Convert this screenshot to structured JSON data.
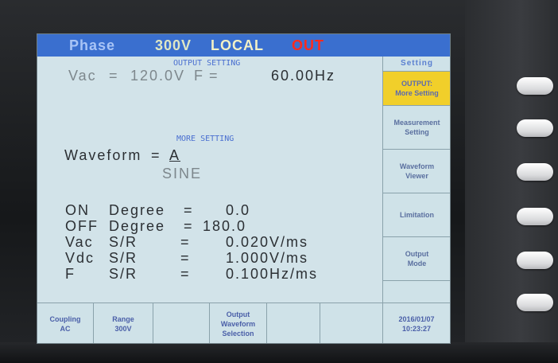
{
  "status": {
    "phase": "Phase",
    "voltage_range": "300V",
    "mode": "LOCAL",
    "output_state": "OUT"
  },
  "output_setting": {
    "title": "OUTPUT SETTING",
    "vac_label": "Vac",
    "eq1": "=",
    "vac_value": "120.0V",
    "f_label": "F",
    "eq2": "=",
    "f_value": "60.00Hz"
  },
  "more_setting": {
    "title": "MORE SETTING",
    "waveform_label": "Waveform",
    "eq": "=",
    "waveform_value": "A",
    "waveform_name": "SINE",
    "rows": [
      {
        "a": "ON",
        "b": "Degree",
        "eq": "=",
        "value": "0.0"
      },
      {
        "a": "OFF",
        "b": "Degree",
        "eq": "=",
        "value": "180.0"
      },
      {
        "a": "Vac",
        "b": "S/R",
        "eq": "=",
        "value": "0.020V/ms"
      },
      {
        "a": "Vdc",
        "b": "S/R",
        "eq": "=",
        "value": "1.000V/ms"
      },
      {
        "a": "F",
        "b": "S/R",
        "eq": "=",
        "value": "0.100Hz/ms"
      }
    ]
  },
  "side_menu": {
    "header": "Setting",
    "items": [
      {
        "line1": "OUTPUT:",
        "line2": "More Setting"
      },
      {
        "line1": "Measurement",
        "line2": "Setting"
      },
      {
        "line1": "Waveform",
        "line2": "Viewer"
      },
      {
        "line1": "Limitation",
        "line2": ""
      },
      {
        "line1": "Output",
        "line2": "Mode"
      },
      {
        "line1": "",
        "line2": ""
      }
    ]
  },
  "bottom_bar": {
    "coupling": {
      "line1": "Coupling",
      "line2": "AC"
    },
    "range": {
      "line1": "Range",
      "line2": "300V"
    },
    "output_waveform": {
      "line1": "Output",
      "line2": "Waveform",
      "line3": "Selection"
    },
    "date": "2016/01/07",
    "time": "10:23:27"
  },
  "colors": {
    "screen_bg": "#d2e3e9",
    "status_bar": "#3a6fcf",
    "active_key": "#f1cf2a",
    "out_red": "#ff2b1f"
  }
}
